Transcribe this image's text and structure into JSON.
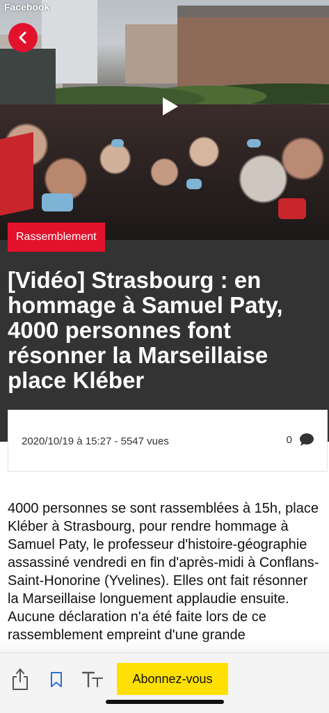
{
  "status_bar": {
    "app_label": "Facebook"
  },
  "hero": {
    "back_icon": "chevron-left-icon",
    "play_icon": "play-icon"
  },
  "article": {
    "category": "Rassemblement",
    "title": "[Vidéo] Strasbourg : en hommage à Samuel Paty, 4000 personnes font résonner la Marseillaise place Kléber",
    "meta": {
      "date_views": "2020/10/19 à 15:27  - 5547 vues",
      "comment_count": "0"
    },
    "body": "4000 personnes se sont rassemblées à 15h, place Kléber à Strasbourg, pour rendre hommage à Samuel Paty, le professeur d'histoire-géographie assassiné vendredi en fin d'après-midi à Conflans-Saint-Honorine (Yvelines). Elles ont fait résonner la Marseillaise longuement applaudie ensuite. Aucune déclaration n'a été faite lors de ce rassemblement empreint d'une grande"
  },
  "toolbar": {
    "share_icon": "share-icon",
    "bookmark_icon": "bookmark-icon",
    "text_size_icon": "text-size-icon",
    "subscribe_label": "Abonnez-vous"
  },
  "colors": {
    "accent_red": "#e2122d",
    "subscribe_yellow": "#ffe000",
    "header_dark": "#333333",
    "bookmark_blue": "#2b6fd6"
  }
}
